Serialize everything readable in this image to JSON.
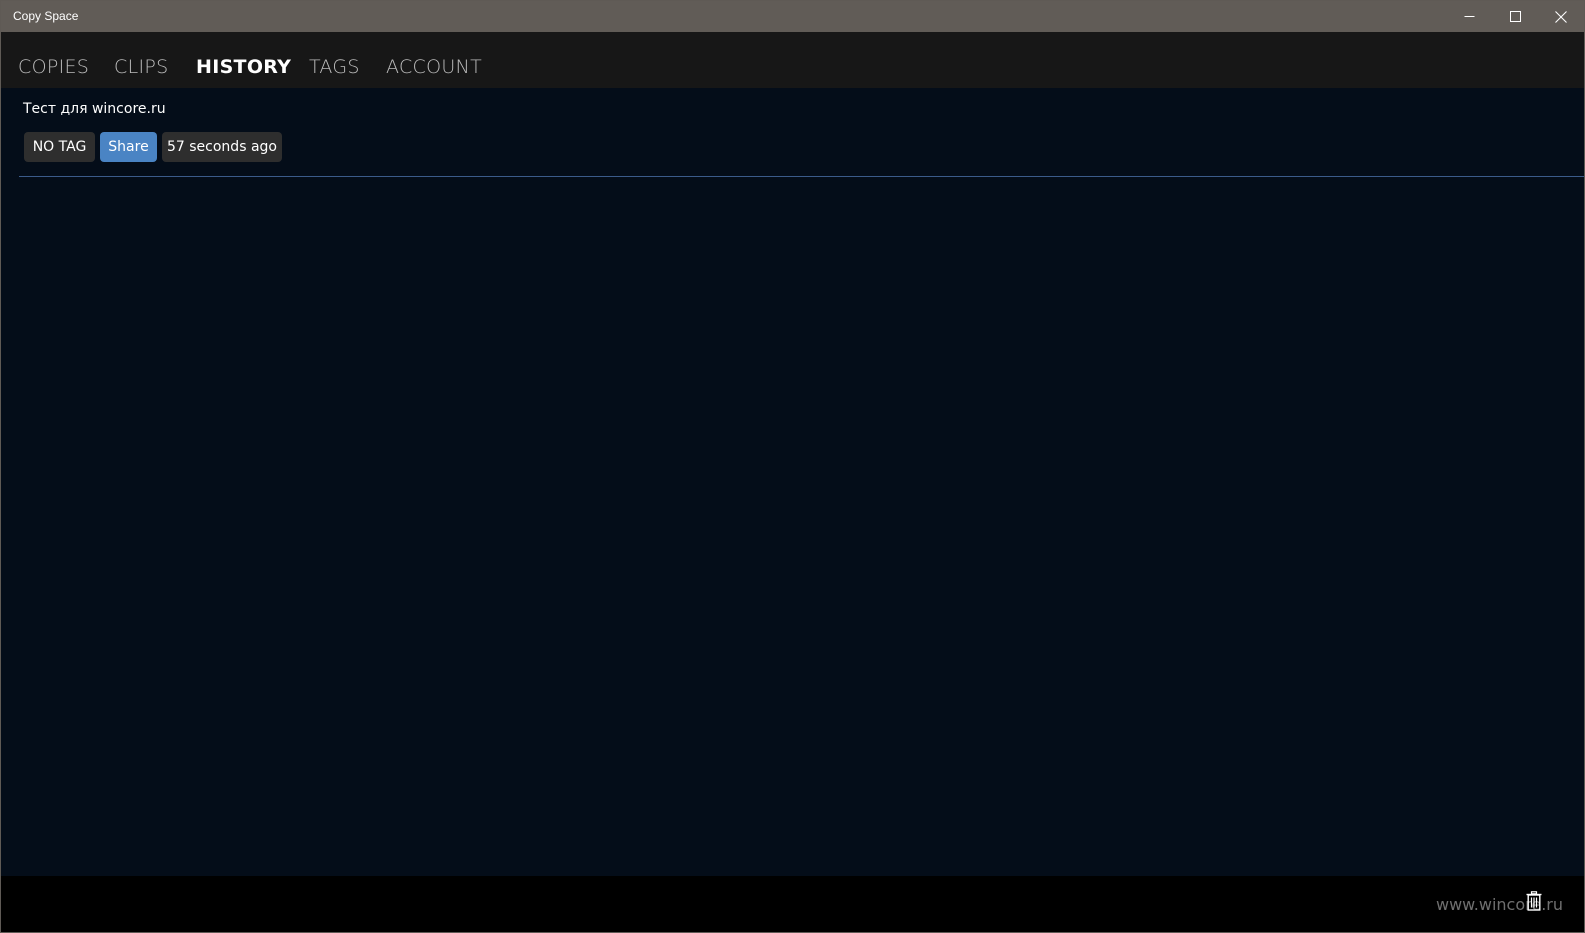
{
  "window": {
    "title": "Copy Space",
    "controls": {
      "minimize_icon": "minimize-icon",
      "maximize_icon": "maximize-icon",
      "close_icon": "close-icon"
    }
  },
  "tabs": [
    {
      "label": "COPIES",
      "active": false
    },
    {
      "label": "CLIPS",
      "active": false
    },
    {
      "label": "HISTORY",
      "active": true
    },
    {
      "label": "TAGS",
      "active": false
    },
    {
      "label": "ACCOUNT",
      "active": false
    }
  ],
  "history": {
    "items": [
      {
        "text": "Тест для wincore.ru",
        "tag_label": "NO TAG",
        "share_label": "Share",
        "time_label": "57 seconds ago"
      }
    ]
  },
  "footer": {
    "watermark": "www.wincore.ru",
    "trash_icon": "trash-icon"
  },
  "colors": {
    "titlebar": "#615c57",
    "tabbar": "#171717",
    "content_bg": "#040d19",
    "accent_underline": "#e8a33a",
    "share_button": "#4a84c4",
    "chip_bg": "#2e2e2e",
    "divider": "#3b5b8a"
  }
}
